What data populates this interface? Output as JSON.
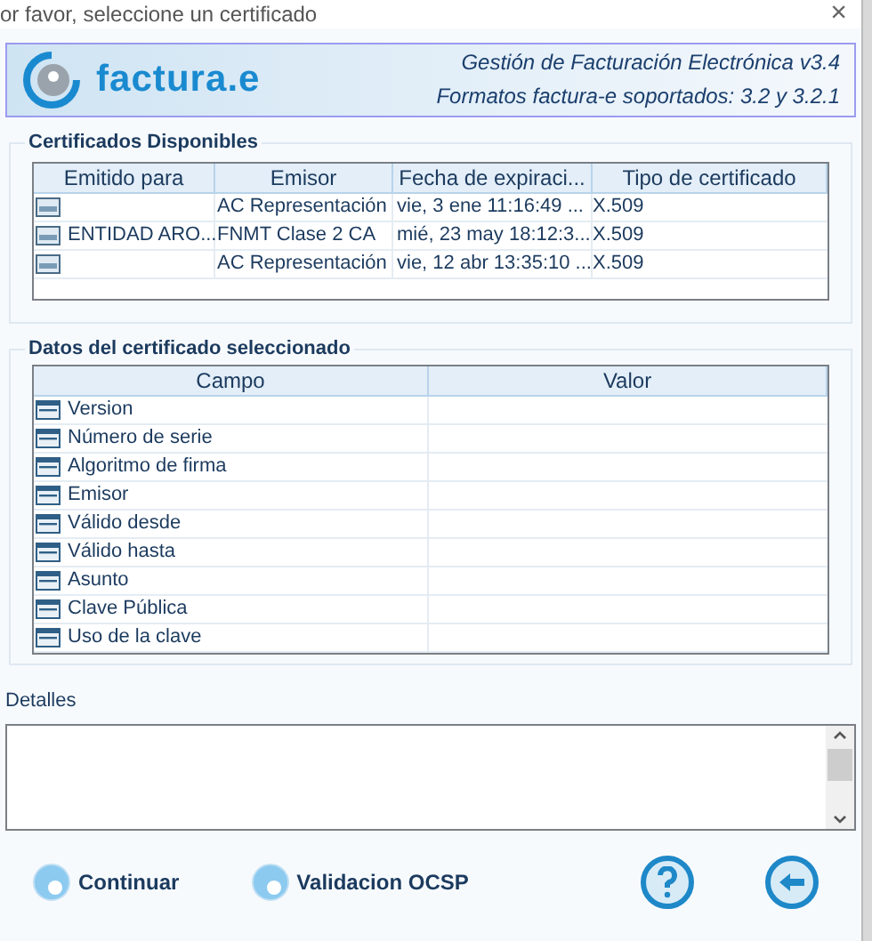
{
  "window": {
    "title": "or favor, seleccione un certificado",
    "close": "×"
  },
  "banner": {
    "logo_text": "factura.e",
    "line_1": "Gestión de Facturación Electrónica v3.4",
    "line_2": "Formatos factura-e soportados: 3.2 y 3.2.1"
  },
  "certificates": {
    "title": "Certificados Disponibles",
    "columns": [
      "Emitido para",
      "Emisor",
      "Fecha de expiraci...",
      "Tipo de certificado"
    ],
    "rows": [
      {
        "issuer": "AC Representación",
        "expiry": "vie, 3 ene 11:16:49 ...",
        "type": "X.509"
      },
      {
        "issued_to": "ENTIDAD ARO...",
        "issuer": "FNMT Clase 2 CA",
        "expiry": "mié, 23 may 18:12:3...",
        "type": "X.509"
      },
      {
        "issuer": "AC Representación",
        "expiry": "vie, 12 abr 13:35:10 ...",
        "type": "X.509"
      }
    ]
  },
  "details_table": {
    "title": "Datos del certificado seleccionado",
    "columns": [
      "Campo",
      "Valor"
    ],
    "rows": [
      "Version",
      "Número de serie",
      "Algoritmo de firma",
      "Emisor",
      "Válido desde",
      "Válido hasta",
      "Asunto",
      "Clave Pública",
      "Uso de la clave"
    ]
  },
  "details": {
    "label": "Detalles"
  },
  "buttons": [
    {
      "kind": "radio",
      "label": "Continuar",
      "selected": false
    },
    {
      "kind": "radio",
      "label": "Validacion OCSP",
      "selected": false
    },
    {
      "kind": "help"
    },
    {
      "kind": "back"
    }
  ]
}
